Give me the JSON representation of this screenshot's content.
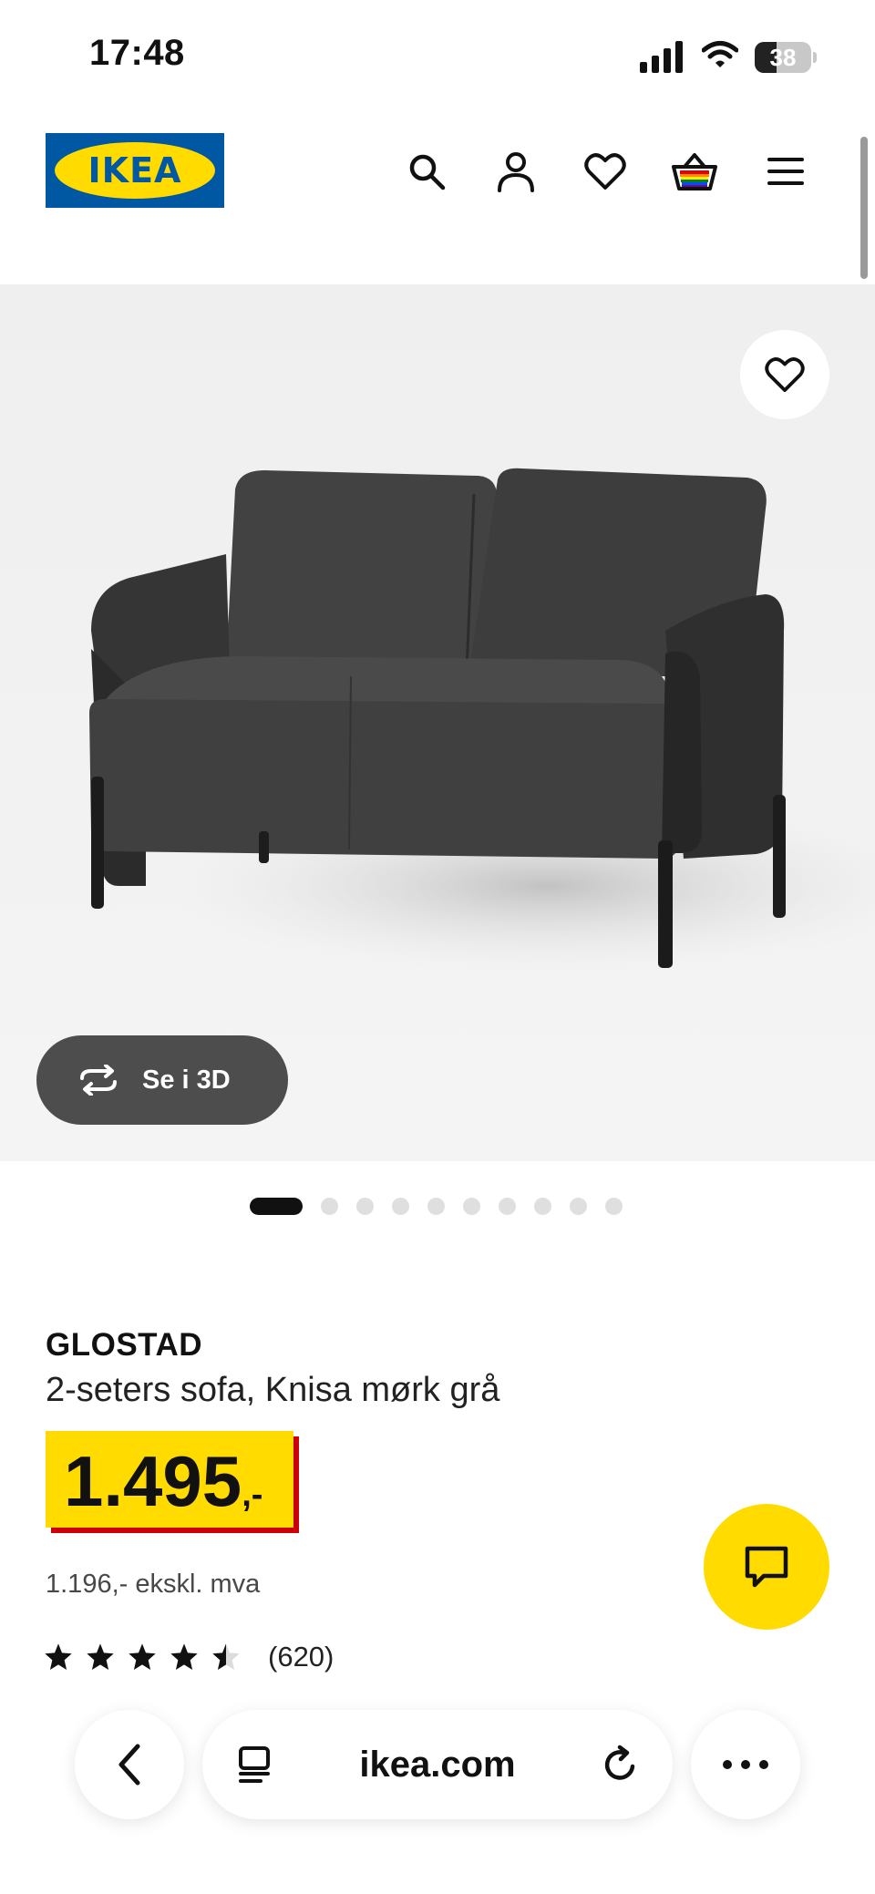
{
  "status_bar": {
    "time": "17:48",
    "battery_level": "38",
    "icons": [
      "signal-icon",
      "wifi-icon",
      "battery-icon"
    ]
  },
  "header": {
    "logo_text": "IKEA",
    "icons": [
      "search-icon",
      "user-icon",
      "heart-icon",
      "basket-icon",
      "menu-icon"
    ]
  },
  "product_image": {
    "view_3d_label": "Se i 3D",
    "slide_count": 10,
    "active_slide": 1
  },
  "product": {
    "name": "GLOSTAD",
    "description": "2-seters sofa, Knisa mørk grå",
    "price": "1.495",
    "price_suffix": ",-",
    "price_excl_vat": "1.196,- ekskl. mva",
    "rating": 4.5,
    "review_count": "(620)"
  },
  "browser_bar": {
    "url": "ikea.com",
    "icons": [
      "back-icon",
      "tabs-icon",
      "reload-icon",
      "more-icon"
    ]
  },
  "colors": {
    "ikea_blue": "#0058a3",
    "ikea_yellow": "#ffdb00",
    "price_red": "#cc0008"
  }
}
